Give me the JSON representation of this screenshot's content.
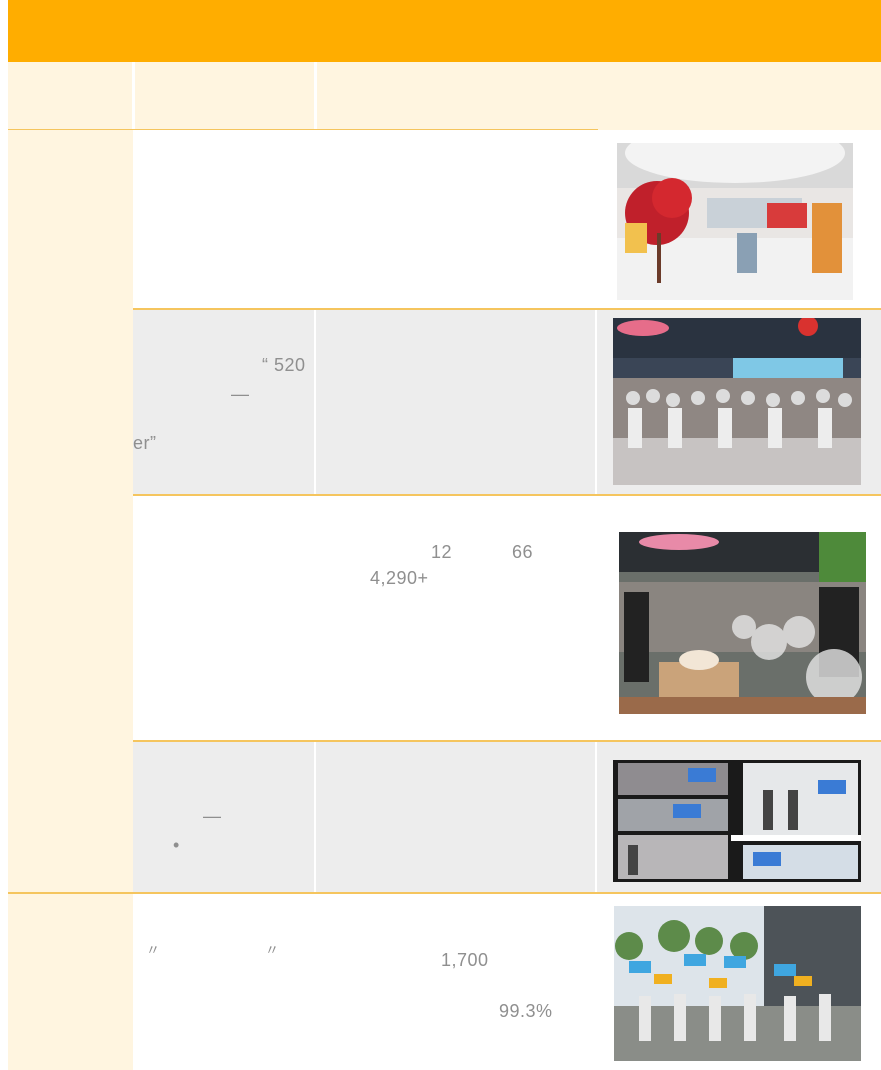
{
  "table": {
    "rows": [
      {
        "id": "r1",
        "texts": []
      },
      {
        "id": "r2",
        "texts": [
          "“ 520",
          "—",
          "er”"
        ]
      },
      {
        "id": "r3",
        "texts": [
          "12",
          "66",
          "4,290+"
        ]
      },
      {
        "id": "r4",
        "texts": [
          "—",
          "•"
        ]
      },
      {
        "id": "r5",
        "texts": [
          "〃",
          "〃",
          "1,700",
          "99.3%"
        ]
      }
    ]
  },
  "colors": {
    "header": "#FFAD00",
    "label_bg": "#FFF5E0",
    "row_gray": "#EDEDED",
    "separator": "#F5C55E"
  }
}
